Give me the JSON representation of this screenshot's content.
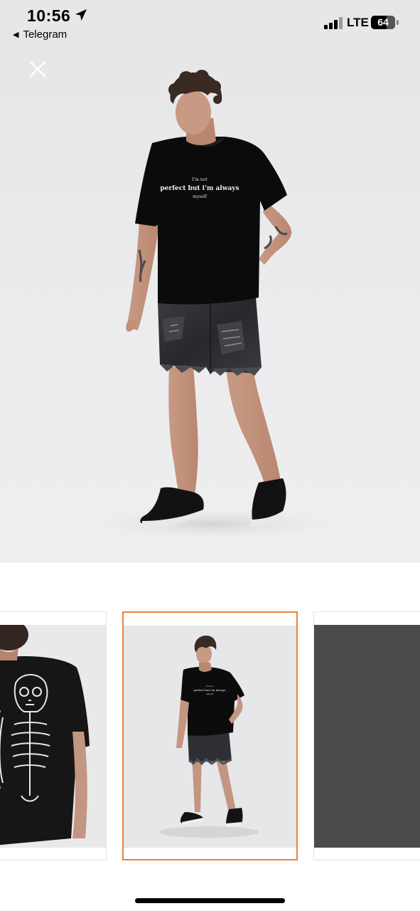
{
  "status_bar": {
    "time": "10:56",
    "back_app": "Telegram",
    "network": "LTE",
    "battery": "64",
    "battery_level": 0.64
  },
  "viewer": {
    "close_icon": "close-icon",
    "shirt_print_line1": "I'm not",
    "shirt_print_line2": "perfect but i'm always",
    "shirt_print_line3": "myself"
  },
  "thumbnails": {
    "selected_index": 1,
    "count": 3,
    "accent_color": "#e8823a"
  },
  "colors": {
    "background": "#ececee",
    "shirt": "#0b0b0c",
    "denim": "#2f3034",
    "thumb_dark": "#4b4b4b"
  }
}
